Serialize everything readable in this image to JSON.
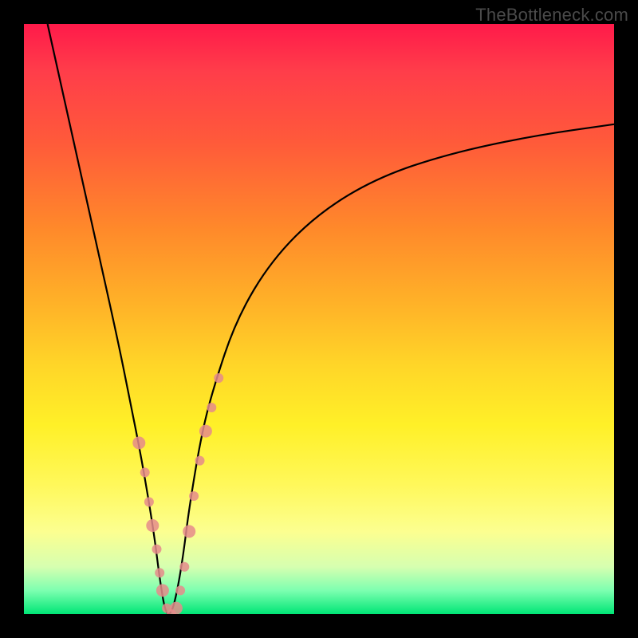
{
  "watermark": "TheBottleneck.com",
  "chart_data": {
    "type": "line",
    "title": "",
    "xlabel": "",
    "ylabel": "",
    "xlim": [
      0,
      100
    ],
    "ylim": [
      0,
      100
    ],
    "grid": false,
    "legend": false,
    "background_gradient": {
      "top": "#ff1a4a",
      "bottom": "#00e676",
      "meaning": "color band from red (high bottleneck) at top to green (low bottleneck) at bottom"
    },
    "series": [
      {
        "name": "bottleneck-curve",
        "stroke": "#000000",
        "x": [
          4,
          8,
          12,
          16,
          18,
          20,
          22,
          23,
          24,
          25,
          26,
          27,
          28,
          30,
          32,
          36,
          42,
          50,
          60,
          72,
          86,
          100
        ],
        "y": [
          100,
          82,
          64,
          46,
          36,
          26,
          14,
          6,
          0,
          0,
          4,
          10,
          18,
          30,
          38,
          50,
          60,
          68,
          74,
          78,
          81,
          83
        ]
      },
      {
        "name": "highlight-dots",
        "type": "scatter",
        "color": "#e58b8b",
        "x": [
          19.5,
          20.5,
          21.2,
          21.8,
          22.5,
          23.0,
          23.5,
          24.2,
          25.0,
          25.8,
          26.5,
          27.2,
          28.0,
          28.8,
          29.8,
          30.8,
          31.8,
          33.0
        ],
        "y": [
          29,
          24,
          19,
          15,
          11,
          7,
          4,
          1,
          0,
          1,
          4,
          8,
          14,
          20,
          26,
          31,
          35,
          40
        ]
      }
    ],
    "valley_x": 24.5,
    "valley_y": 0
  }
}
